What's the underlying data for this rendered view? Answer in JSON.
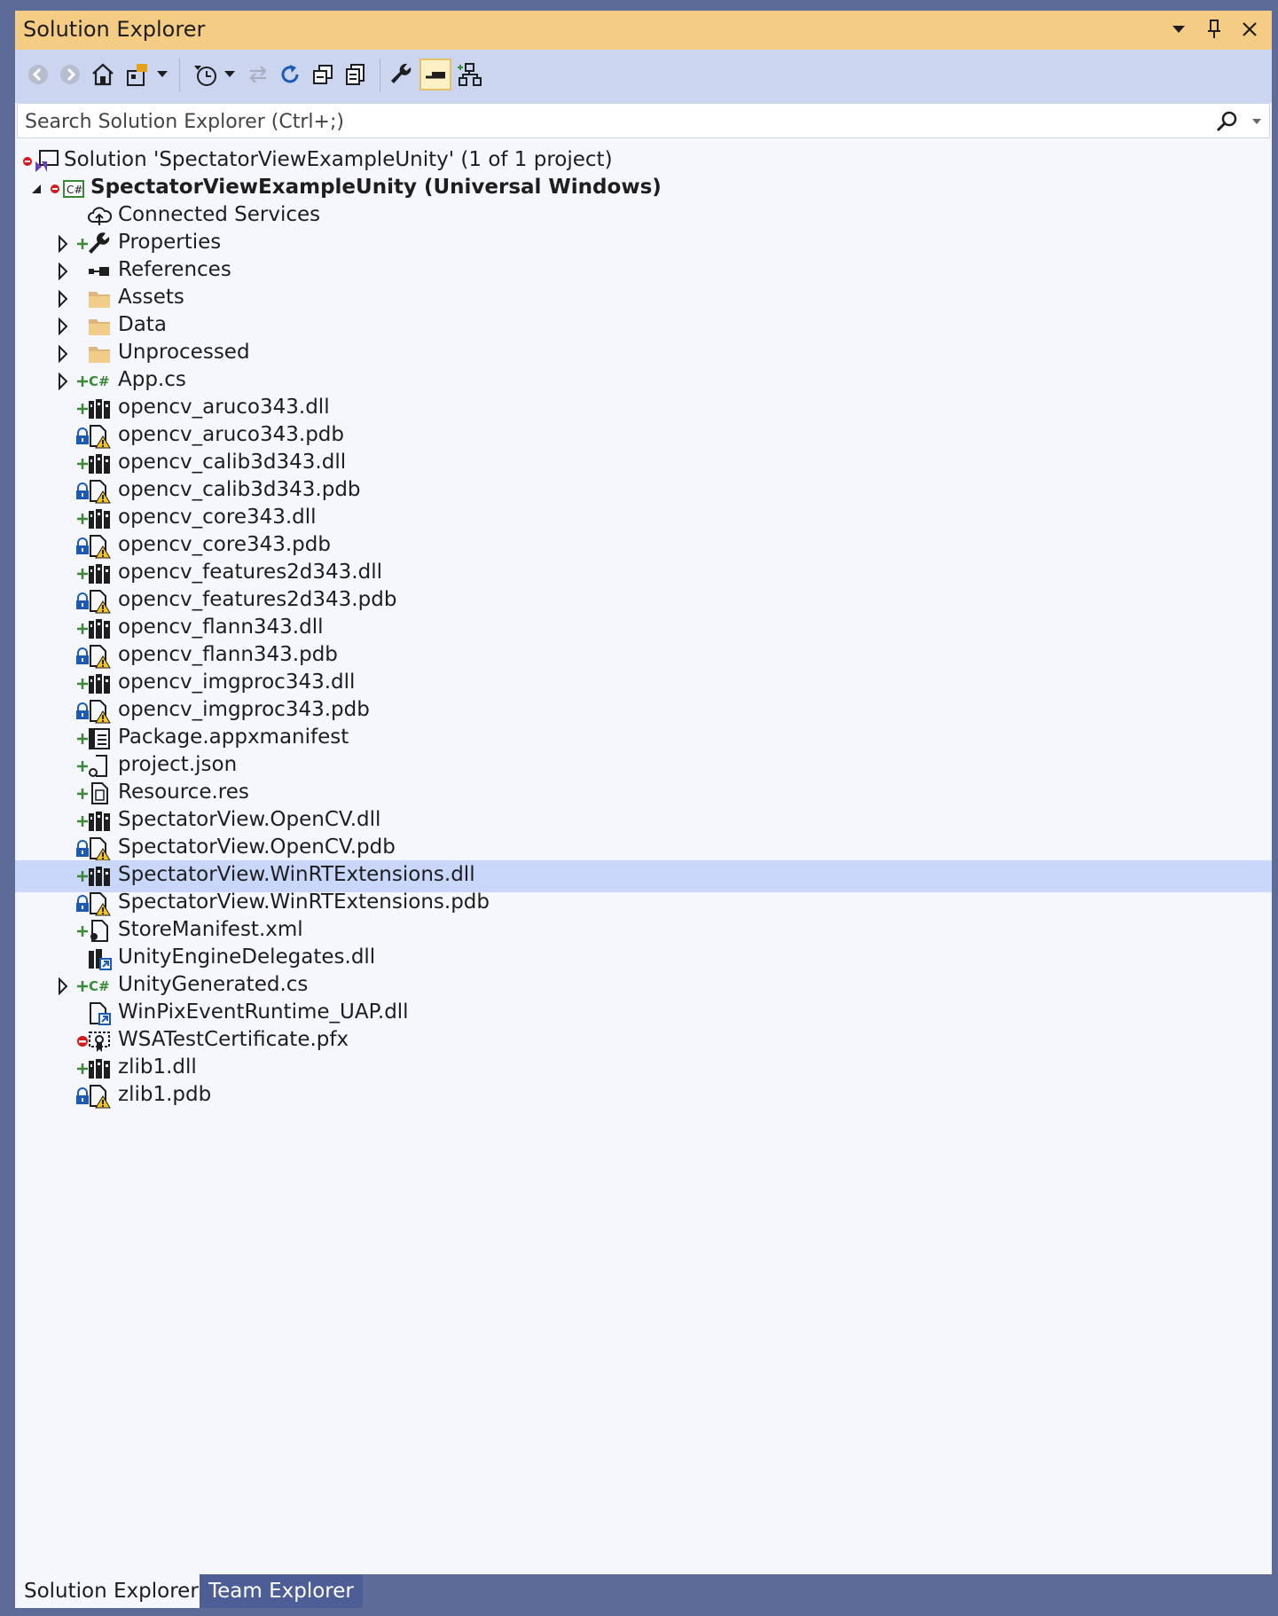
{
  "window": {
    "title": "Solution Explorer"
  },
  "search": {
    "placeholder": "Search Solution Explorer (Ctrl+;)"
  },
  "tree": {
    "solution_label": "Solution 'SpectatorViewExampleUnity' (1 of 1 project)",
    "project_label": "SpectatorViewExampleUnity (Universal Windows)",
    "items": [
      {
        "label": "Connected Services",
        "icon": "cloud-services-icon",
        "expand": false,
        "overlay": ""
      },
      {
        "label": "Properties",
        "icon": "wrench-icon",
        "expand": true,
        "overlay": "add"
      },
      {
        "label": "References",
        "icon": "references-icon",
        "expand": true,
        "overlay": ""
      },
      {
        "label": "Assets",
        "icon": "folder-icon",
        "expand": true,
        "overlay": ""
      },
      {
        "label": "Data",
        "icon": "folder-icon",
        "expand": true,
        "overlay": ""
      },
      {
        "label": "Unprocessed",
        "icon": "folder-icon",
        "expand": true,
        "overlay": ""
      },
      {
        "label": "App.cs",
        "icon": "csharp-file-icon",
        "expand": true,
        "overlay": "add"
      },
      {
        "label": "opencv_aruco343.dll",
        "icon": "dll-icon",
        "expand": false,
        "overlay": "add"
      },
      {
        "label": "opencv_aruco343.pdb",
        "icon": "pdb-warning-icon",
        "expand": false,
        "overlay": "lock"
      },
      {
        "label": "opencv_calib3d343.dll",
        "icon": "dll-icon",
        "expand": false,
        "overlay": "add"
      },
      {
        "label": "opencv_calib3d343.pdb",
        "icon": "pdb-warning-icon",
        "expand": false,
        "overlay": "lock"
      },
      {
        "label": "opencv_core343.dll",
        "icon": "dll-icon",
        "expand": false,
        "overlay": "add"
      },
      {
        "label": "opencv_core343.pdb",
        "icon": "pdb-warning-icon",
        "expand": false,
        "overlay": "lock"
      },
      {
        "label": "opencv_features2d343.dll",
        "icon": "dll-icon",
        "expand": false,
        "overlay": "add"
      },
      {
        "label": "opencv_features2d343.pdb",
        "icon": "pdb-warning-icon",
        "expand": false,
        "overlay": "lock"
      },
      {
        "label": "opencv_flann343.dll",
        "icon": "dll-icon",
        "expand": false,
        "overlay": "add"
      },
      {
        "label": "opencv_flann343.pdb",
        "icon": "pdb-warning-icon",
        "expand": false,
        "overlay": "lock"
      },
      {
        "label": "opencv_imgproc343.dll",
        "icon": "dll-icon",
        "expand": false,
        "overlay": "add"
      },
      {
        "label": "opencv_imgproc343.pdb",
        "icon": "pdb-warning-icon",
        "expand": false,
        "overlay": "lock"
      },
      {
        "label": "Package.appxmanifest",
        "icon": "manifest-icon",
        "expand": false,
        "overlay": "add"
      },
      {
        "label": "project.json",
        "icon": "json-file-icon",
        "expand": false,
        "overlay": "add"
      },
      {
        "label": "Resource.res",
        "icon": "resource-file-icon",
        "expand": false,
        "overlay": "add"
      },
      {
        "label": "SpectatorView.OpenCV.dll",
        "icon": "dll-icon",
        "expand": false,
        "overlay": "add"
      },
      {
        "label": "SpectatorView.OpenCV.pdb",
        "icon": "pdb-warning-icon",
        "expand": false,
        "overlay": "lock"
      },
      {
        "label": "SpectatorView.WinRTExtensions.dll",
        "icon": "dll-icon",
        "expand": false,
        "overlay": "add",
        "selected": true
      },
      {
        "label": "SpectatorView.WinRTExtensions.pdb",
        "icon": "pdb-warning-icon",
        "expand": false,
        "overlay": "lock"
      },
      {
        "label": "StoreManifest.xml",
        "icon": "xml-file-icon",
        "expand": false,
        "overlay": "add"
      },
      {
        "label": "UnityEngineDelegates.dll",
        "icon": "dll-link-icon",
        "expand": false,
        "overlay": ""
      },
      {
        "label": "UnityGenerated.cs",
        "icon": "csharp-file-icon",
        "expand": true,
        "overlay": "add"
      },
      {
        "label": "WinPixEventRuntime_UAP.dll",
        "icon": "file-link-icon",
        "expand": false,
        "overlay": ""
      },
      {
        "label": "WSATestCertificate.pfx",
        "icon": "certificate-icon",
        "expand": false,
        "overlay": "excluded"
      },
      {
        "label": "zlib1.dll",
        "icon": "dll-icon",
        "expand": false,
        "overlay": "add"
      },
      {
        "label": "zlib1.pdb",
        "icon": "pdb-warning-icon",
        "expand": false,
        "overlay": "lock"
      }
    ]
  },
  "tabs": {
    "solution_explorer": "Solution Explorer",
    "team_explorer": "Team Explorer"
  },
  "colors": {
    "titlebar": "#f5cc84",
    "toolbar": "#ccd5f0",
    "selection": "#c9d8fa",
    "frame": "#5d6b99"
  }
}
